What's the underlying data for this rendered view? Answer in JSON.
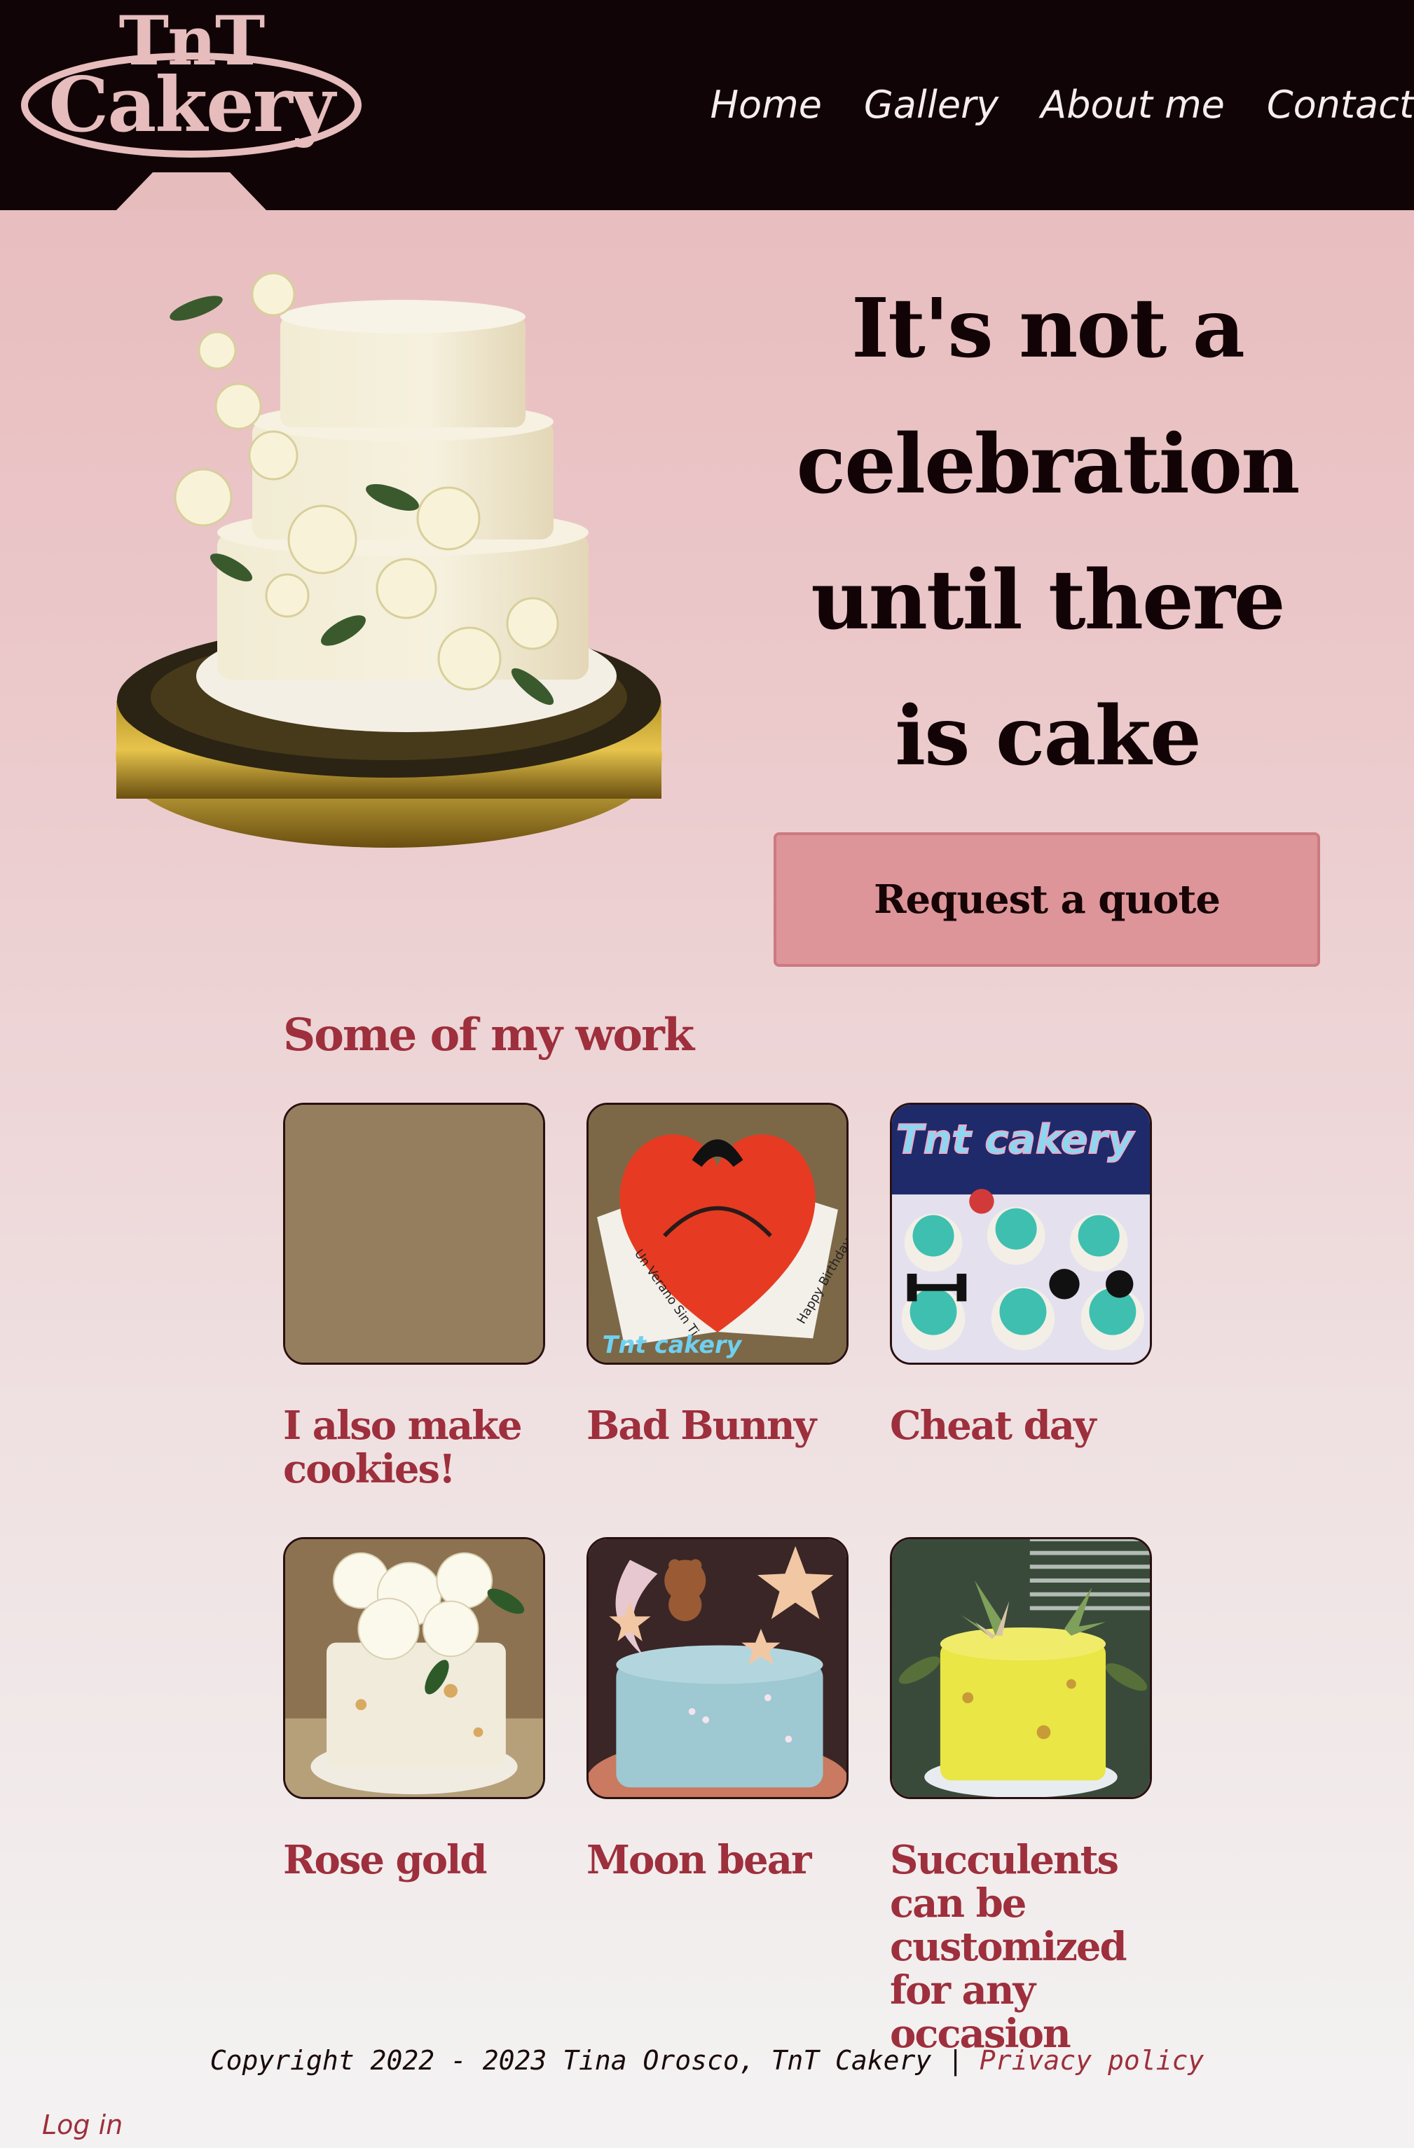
{
  "brand": {
    "logo_line1": "TnT",
    "logo_line2": "Cakery"
  },
  "nav": {
    "items": [
      {
        "label": "Home"
      },
      {
        "label": "Gallery"
      },
      {
        "label": "About me"
      },
      {
        "label": "Contact"
      }
    ]
  },
  "hero": {
    "title": "It's not a celebration until there is cake",
    "cta_label": "Request a quote"
  },
  "gallery": {
    "heading": "Some of my work",
    "items": [
      {
        "caption": "I also make cookies!"
      },
      {
        "caption": "Bad Bunny"
      },
      {
        "caption": "Cheat day"
      },
      {
        "caption": "Rose gold"
      },
      {
        "caption": "Moon bear"
      },
      {
        "caption": "Succulents can be customized for any occasion"
      }
    ],
    "thumb_text": {
      "bad_bunny_brand": "Tnt cakery",
      "bad_bunny_card_left": "Un Verano Sin Ti",
      "bad_bunny_card_right": "Happy Birthday Kassy",
      "cheat_day_brand": "Tnt cakery"
    }
  },
  "footer": {
    "copyright": "Copyright 2022 - 2023 Tina Orosco, TnT Cakery | ",
    "privacy_label": "Privacy policy",
    "login_label": "Log in"
  },
  "colors": {
    "header_bg": "#110406",
    "accent": "#9e2f3c",
    "button_bg": "#dd9599",
    "logo_pink": "#e6bcbc"
  }
}
